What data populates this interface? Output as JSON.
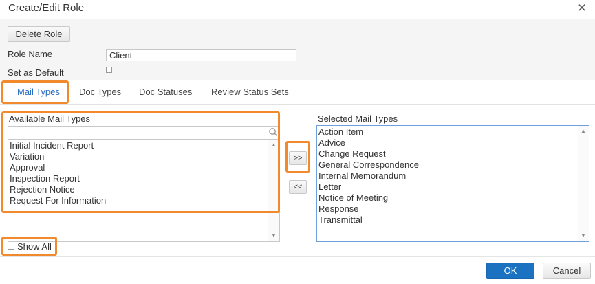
{
  "dialog": {
    "title": "Create/Edit Role",
    "close_icon": "×"
  },
  "role_section": {
    "delete_label": "Delete Role",
    "role_name_label": "Role Name",
    "role_name_value": "Client",
    "set_default_label": "Set as Default",
    "set_default_checked": false
  },
  "tabs": [
    {
      "label": "Mail Types",
      "active": true
    },
    {
      "label": "Doc Types",
      "active": false
    },
    {
      "label": "Doc Statuses",
      "active": false
    },
    {
      "label": "Review Status Sets",
      "active": false
    }
  ],
  "available": {
    "label": "Available Mail Types",
    "filter_value": "",
    "items": [
      "Initial Incident Report",
      "Variation",
      "Approval",
      "Inspection Report",
      "Rejection Notice",
      "Request For Information"
    ]
  },
  "transfer": {
    "add_label": ">>",
    "remove_label": "<<"
  },
  "selected": {
    "label": "Selected Mail Types",
    "items": [
      "Action Item",
      "Advice",
      "Change Request",
      "General Correspondence",
      "Internal Memorandum",
      "Letter",
      "Notice of Meeting",
      "Response",
      "Transmittal"
    ]
  },
  "show_all": {
    "label": "Show All",
    "checked": false
  },
  "footer": {
    "ok_label": "OK",
    "cancel_label": "Cancel"
  },
  "colors": {
    "highlight": "#f08a2c",
    "primary": "#1b72c0",
    "active_tab": "#2a6dbd"
  }
}
